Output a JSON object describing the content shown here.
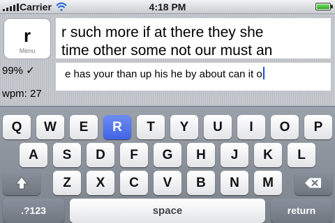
{
  "status_bar": {
    "carrier": "Carrier",
    "time": "4:18 PM"
  },
  "panel": {
    "menu_letter": "r",
    "menu_label": "Menu",
    "accuracy": "99% ✓",
    "wpm": "wpm: 27",
    "prompt_lines": [
      "r such more if at there they she",
      "time other some not our must an"
    ],
    "typed_text": "e has your than up his he by about can it o"
  },
  "keyboard": {
    "row1": [
      "Q",
      "W",
      "E",
      "R",
      "T",
      "Y",
      "U",
      "I",
      "O",
      "P"
    ],
    "row2": [
      "A",
      "S",
      "D",
      "F",
      "G",
      "H",
      "J",
      "K",
      "L"
    ],
    "row3": [
      "Z",
      "X",
      "C",
      "V",
      "B",
      "N",
      "M"
    ],
    "highlighted_key": "R",
    "numbers_label": ".?123",
    "space_label": "space",
    "return_label": "return",
    "shift_icon": "shift-arrow",
    "backspace_icon": "backspace"
  },
  "colors": {
    "highlight": "#4a6ee8",
    "cursor": "#1c4fd8"
  }
}
